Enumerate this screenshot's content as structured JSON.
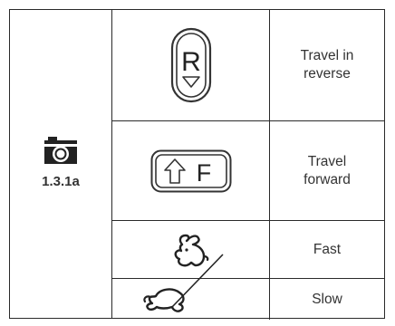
{
  "reference": {
    "icon": "camera-icon",
    "label": "1.3.1a"
  },
  "rows": [
    {
      "icon": "reverse-travel-icon",
      "symbol": "R",
      "description": "Travel in\nreverse"
    },
    {
      "icon": "forward-travel-icon",
      "symbol": "F",
      "description": "Travel\nforward"
    },
    {
      "icon": "rabbit-fast-icon",
      "description": "Fast"
    },
    {
      "icon": "turtle-slow-icon",
      "description": "Slow"
    }
  ]
}
